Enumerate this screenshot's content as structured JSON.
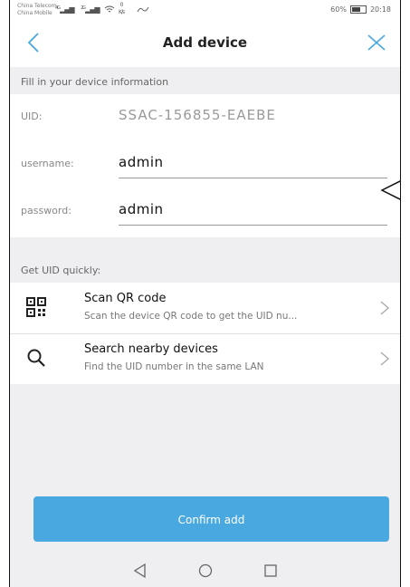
{
  "statusbar": {
    "carrier1": "China Telecom",
    "carrier2": "China Mobile",
    "signal1": "4G",
    "signal2": "2G",
    "speed": "0",
    "speed_unit": "K/s",
    "battery": "60%",
    "time": "20:18"
  },
  "header": {
    "title": "Add device"
  },
  "form": {
    "section_label": "Fill in your device information",
    "uid_label": "UID:",
    "uid_value": "SSAC-156855-EAEBE",
    "username_label": "username:",
    "username_value": "admin",
    "password_label": "password:",
    "password_value": "admin"
  },
  "quick": {
    "section_label": "Get UID quickly:",
    "items": [
      {
        "title": "Scan QR code",
        "subtitle": "Scan the device QR code to get the UID nu...",
        "icon": "qr-code-icon"
      },
      {
        "title": "Search nearby devices",
        "subtitle": "Find the UID number in the same LAN",
        "icon": "search-icon"
      }
    ]
  },
  "confirm_label": "Confirm add",
  "colors": {
    "accent": "#4aa8e1",
    "background": "#efeff2"
  }
}
